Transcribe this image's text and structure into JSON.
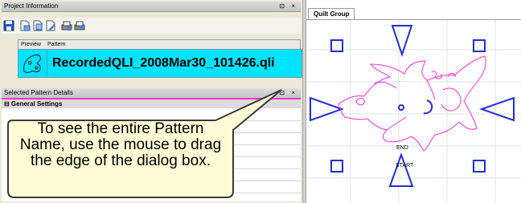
{
  "project_panel": {
    "title": "Project Information",
    "controls": "⊡ ×"
  },
  "toolbar": {
    "icons": [
      "save-icon",
      "document-icon",
      "document-copy-icon",
      "document-edit-icon",
      "print-icon",
      "print-preview-icon"
    ]
  },
  "pattern_grid": {
    "columns": [
      "Preview",
      "Pattern"
    ],
    "selected_pattern": "RecordedQLI_2008Mar30_101426.qli"
  },
  "details_panel": {
    "title": "Selected Pattern Details",
    "controls": "⊡ ×",
    "section": "⊟ General Settings"
  },
  "callout": {
    "text": "To see the entire Pattern Name, use the mouse to drag the edge of the dialog box."
  },
  "quilt": {
    "tab": "Quilt Group",
    "end_label": "END",
    "start_label": "START"
  },
  "colors": {
    "selected_row": "#00e3ff",
    "design_stroke": "#1f2fd6",
    "pattern_stroke": "#ff2bd6",
    "details_accent": "#ff33cc"
  }
}
